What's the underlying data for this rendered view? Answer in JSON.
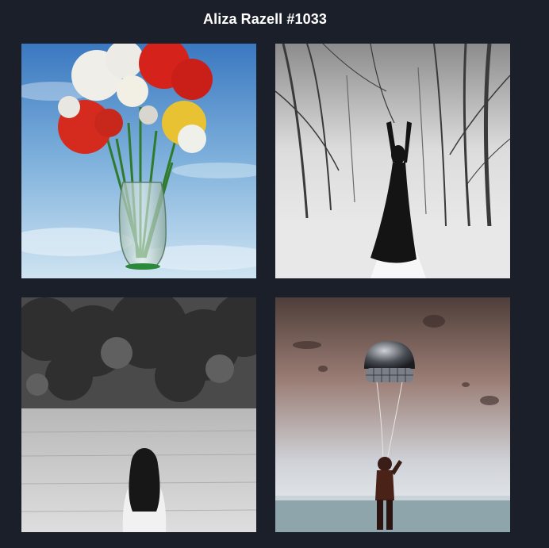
{
  "header": {
    "title": "Aliza Razell #1033"
  },
  "gallery": {
    "images": [
      {
        "subject": "flower-vase",
        "colors": {
          "sky_top": "#3f7fc4",
          "sky_bottom": "#c7dff0",
          "red": "#d3231b",
          "yellow": "#e8c233",
          "white": "#efeee8",
          "stem": "#2f7a2c"
        }
      },
      {
        "subject": "woman-in-winter-forest",
        "colors": {
          "fog": "#e9e9e9",
          "tree": "#3a3a3a",
          "figure": "#141414"
        }
      },
      {
        "subject": "girl-in-wheat-field",
        "colors": {
          "trees": "#3c3c3c",
          "field": "#cfcfcf",
          "hair": "#171717"
        }
      },
      {
        "subject": "child-with-balloon-pod",
        "colors": {
          "sky_top": "#5a4844",
          "sky_mid": "#a88e86",
          "horizon": "#d6d9de",
          "ground": "#8fa6ad",
          "figure": "#3b1d17"
        }
      }
    ]
  }
}
